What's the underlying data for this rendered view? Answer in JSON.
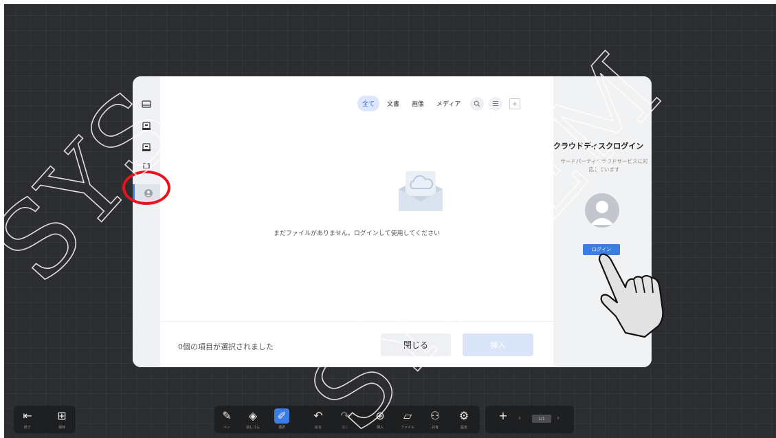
{
  "filters": {
    "tabs": [
      "全て",
      "文書",
      "画像",
      "メディア"
    ],
    "active_tab": "全て",
    "search_icon": "search-icon",
    "list_icon": "list-view-icon",
    "add_icon": "add-folder-icon"
  },
  "sidebar": {
    "items": [
      {
        "icon": "monitor-icon"
      },
      {
        "icon": "usb-drive-icon"
      },
      {
        "icon": "usb-drive-icon"
      },
      {
        "icon": "drive-icon"
      },
      {
        "icon": "cloud-user-icon",
        "active": true
      }
    ]
  },
  "main": {
    "empty_text": "まだファイルがありません。ログインして使用してください",
    "selected_text": "0個の項目が選択されました",
    "close_label": "閉じる",
    "insert_label": "挿入"
  },
  "cloud": {
    "title": "クラウドディスクログイン",
    "desc_line1": "サードパーティクラウドサービスに対",
    "desc_line2": "応しています",
    "login_label": "ログイン"
  },
  "watermark": {
    "text1": "SYS",
    "text2": "SYSTEM"
  },
  "toolbar": {
    "left": [
      {
        "icon": "exit-icon",
        "label": "終了"
      },
      {
        "icon": "grid-icon",
        "label": "保存"
      }
    ],
    "center": [
      {
        "icon": "pen-icon",
        "label": "ペン"
      },
      {
        "icon": "eraser-icon",
        "label": "消しゴム"
      },
      {
        "icon": "select-icon",
        "label": "選択",
        "active": true
      },
      {
        "icon": "undo-icon",
        "label": "戻る"
      },
      {
        "icon": "redo-icon",
        "label": "進む"
      },
      {
        "icon": "insert-icon",
        "label": "挿入"
      },
      {
        "icon": "file-icon",
        "label": "ファイル"
      },
      {
        "icon": "share-icon",
        "label": "共有"
      },
      {
        "icon": "settings-icon",
        "label": "設定"
      }
    ],
    "page": {
      "add_icon": "plus-icon",
      "indicator": "1/1"
    }
  },
  "colors": {
    "accent": "#3b7de6",
    "highlight": "#e8141b",
    "background": "#2b2d30"
  }
}
